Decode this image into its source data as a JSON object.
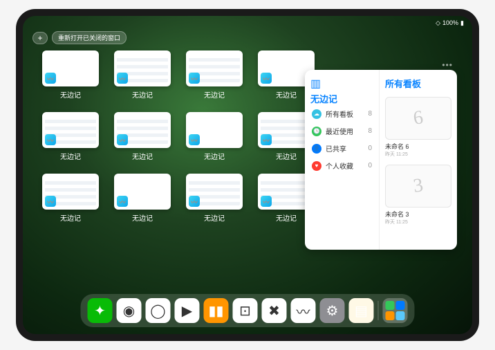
{
  "status": {
    "battery": "100%"
  },
  "controls": {
    "plus": "+",
    "reopen": "重新打开已关闭的窗口"
  },
  "thumb_label": "无边记",
  "windows": [
    {
      "content": false
    },
    {
      "content": true
    },
    {
      "content": true
    },
    {
      "content": false
    },
    {
      "content": true
    },
    {
      "content": true
    },
    {
      "content": false
    },
    {
      "content": true
    },
    {
      "content": true
    },
    {
      "content": false
    },
    {
      "content": true
    },
    {
      "content": true
    }
  ],
  "panel": {
    "title": "无边记",
    "right_title": "所有看板",
    "categories": [
      {
        "label": "所有看板",
        "count": "8",
        "color": "#34c2e3",
        "glyph": "☁"
      },
      {
        "label": "最近使用",
        "count": "8",
        "color": "#34c759",
        "glyph": "🕒"
      },
      {
        "label": "已共享",
        "count": "0",
        "color": "#007aff",
        "glyph": "👤"
      },
      {
        "label": "个人收藏",
        "count": "0",
        "color": "#ff3b30",
        "glyph": "♥"
      }
    ],
    "boards": [
      {
        "sketch": "6",
        "name": "未命名 6",
        "date": "昨天 11:25"
      },
      {
        "sketch": "3",
        "name": "未命名 3",
        "date": "昨天 11:25"
      }
    ]
  },
  "dock": [
    {
      "name": "wechat",
      "bg": "#09bb07",
      "glyph": "✦"
    },
    {
      "name": "quark-hd",
      "bg": "#ffffff",
      "glyph": "◉"
    },
    {
      "name": "quark",
      "bg": "#ffffff",
      "glyph": "◯"
    },
    {
      "name": "play",
      "bg": "#ffffff",
      "glyph": "▶"
    },
    {
      "name": "books",
      "bg": "#ff9500",
      "glyph": "▮▮"
    },
    {
      "name": "dice",
      "bg": "#ffffff",
      "glyph": "⊡"
    },
    {
      "name": "app-x",
      "bg": "#ffffff",
      "glyph": "✖"
    },
    {
      "name": "freeform",
      "bg": "#ffffff",
      "glyph": "〰"
    },
    {
      "name": "settings",
      "bg": "#8e8e93",
      "glyph": "⚙"
    },
    {
      "name": "notes",
      "bg": "#fff9e6",
      "glyph": "▤"
    }
  ]
}
